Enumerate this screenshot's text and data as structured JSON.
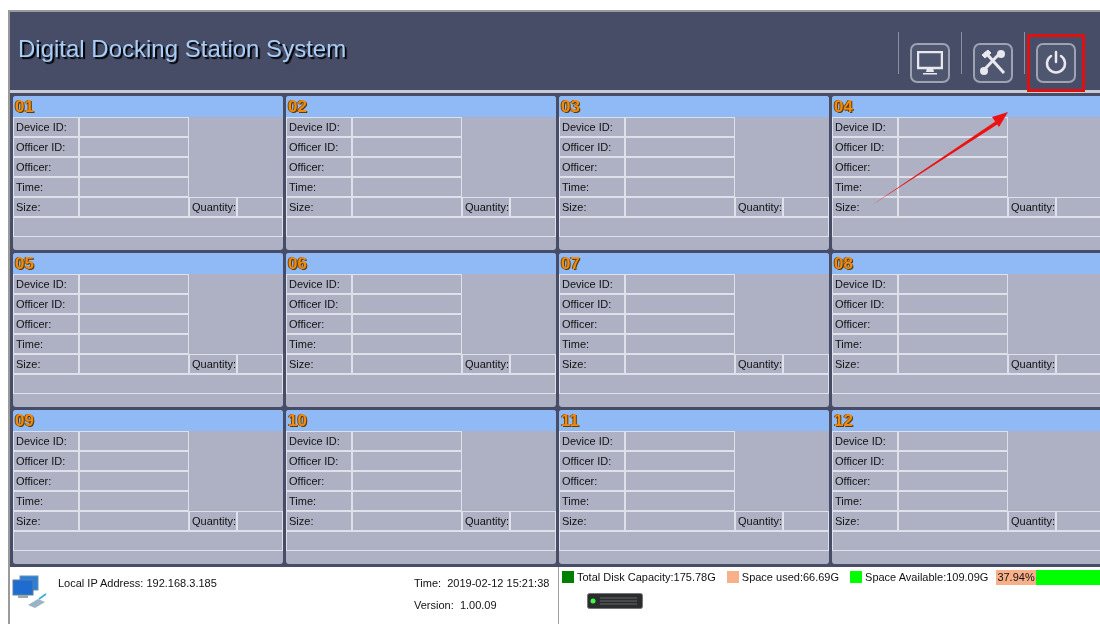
{
  "window": {
    "title": "Digital Docking Station System"
  },
  "toolbar": [
    {
      "kind": "monitor",
      "highlighted": false
    },
    {
      "kind": "tools",
      "highlighted": false
    },
    {
      "kind": "power",
      "highlighted": true
    }
  ],
  "stations": [
    {
      "number": "01",
      "fields": [
        "Device ID:",
        "Officer ID:",
        "Officer:",
        "Time:"
      ],
      "size_label": "Size:",
      "quantity_label": "Quantity:"
    },
    {
      "number": "02",
      "fields": [
        "Device ID:",
        "Officer ID:",
        "Officer:",
        "Time:"
      ],
      "size_label": "Size:",
      "quantity_label": "Quantity:"
    },
    {
      "number": "03",
      "fields": [
        "Device ID:",
        "Officer ID:",
        "Officer:",
        "Time:"
      ],
      "size_label": "Size:",
      "quantity_label": "Quantity:"
    },
    {
      "number": "04",
      "fields": [
        "Device ID:",
        "Officer ID:",
        "Officer:",
        "Time:"
      ],
      "size_label": "Size:",
      "quantity_label": "Quantity:"
    },
    {
      "number": "05",
      "fields": [
        "Device ID:",
        "Officer ID:",
        "Officer:",
        "Time:"
      ],
      "size_label": "Size:",
      "quantity_label": "Quantity:"
    },
    {
      "number": "06",
      "fields": [
        "Device ID:",
        "Officer ID:",
        "Officer:",
        "Time:"
      ],
      "size_label": "Size:",
      "quantity_label": "Quantity:"
    },
    {
      "number": "07",
      "fields": [
        "Device ID:",
        "Officer ID:",
        "Officer:",
        "Time:"
      ],
      "size_label": "Size:",
      "quantity_label": "Quantity:"
    },
    {
      "number": "08",
      "fields": [
        "Device ID:",
        "Officer ID:",
        "Officer:",
        "Time:"
      ],
      "size_label": "Size:",
      "quantity_label": "Quantity:"
    },
    {
      "number": "09",
      "fields": [
        "Device ID:",
        "Officer ID:",
        "Officer:",
        "Time:"
      ],
      "size_label": "Size:",
      "quantity_label": "Quantity:"
    },
    {
      "number": "10",
      "fields": [
        "Device ID:",
        "Officer ID:",
        "Officer:",
        "Time:"
      ],
      "size_label": "Size:",
      "quantity_label": "Quantity:"
    },
    {
      "number": "11",
      "fields": [
        "Device ID:",
        "Officer ID:",
        "Officer:",
        "Time:"
      ],
      "size_label": "Size:",
      "quantity_label": "Quantity:"
    },
    {
      "number": "12",
      "fields": [
        "Device ID:",
        "Officer ID:",
        "Officer:",
        "Time:"
      ],
      "size_label": "Size:",
      "quantity_label": "Quantity:"
    }
  ],
  "status_bar": {
    "ip": "Local IP Address: 192.168.3.185",
    "time_label": "Time:",
    "time": "2019-02-12 15:21:38",
    "version_label": "Version:",
    "version": "1.00.09"
  },
  "disk": {
    "legend": [
      {
        "label": "Total Disk Capacity:",
        "value": "175.78G",
        "color": "#007f00"
      },
      {
        "label": "Space used:",
        "value": "66.69G",
        "color": "#f7b08a"
      },
      {
        "label": "Space Available:",
        "value": "109.09G",
        "color": "#00ff00"
      }
    ],
    "usage": {
      "level": 0.3794,
      "reading": "37.94%"
    }
  }
}
